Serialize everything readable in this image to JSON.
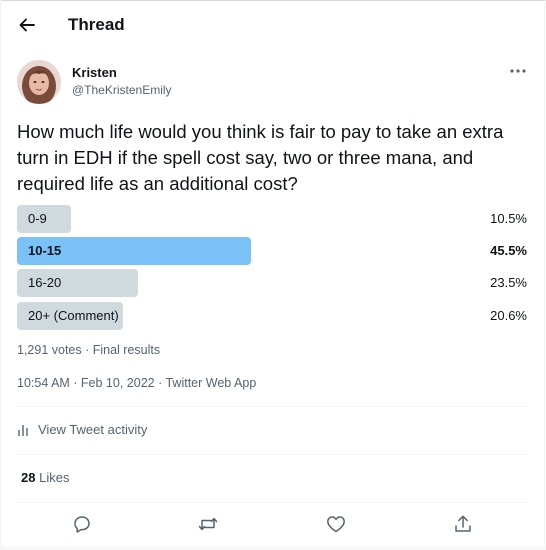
{
  "header": {
    "title": "Thread"
  },
  "author": {
    "name": "Kristen",
    "handle": "@TheKristenEmily"
  },
  "tweet": {
    "text": "How much life would you think is fair to pay to take an extra turn in EDH if the spell cost say, two or three mana, and required life as an additional cost?"
  },
  "poll": {
    "options": [
      {
        "label": "0-9",
        "percent": "10.5%",
        "value": 10.5
      },
      {
        "label": "10-15",
        "percent": "45.5%",
        "value": 45.5
      },
      {
        "label": "16-20",
        "percent": "23.5%",
        "value": 23.5
      },
      {
        "label": "20+ (Comment)",
        "percent": "20.6%",
        "value": 20.6
      }
    ],
    "winner_index": 1,
    "summary": "1,291 votes · Final results",
    "bar_color": "#cfd9de",
    "winner_color": "#7ac1f7"
  },
  "timestamp": {
    "time": "10:54 AM · Feb 10, 2022 · ",
    "source": "Twitter Web App"
  },
  "activity": {
    "label": "View Tweet activity",
    "icon": "analytics-icon"
  },
  "stats": {
    "likes_count": "28",
    "likes_label": "Likes"
  },
  "actions": {
    "reply": "reply-icon",
    "retweet": "retweet-icon",
    "like": "heart-icon",
    "share": "share-icon"
  }
}
